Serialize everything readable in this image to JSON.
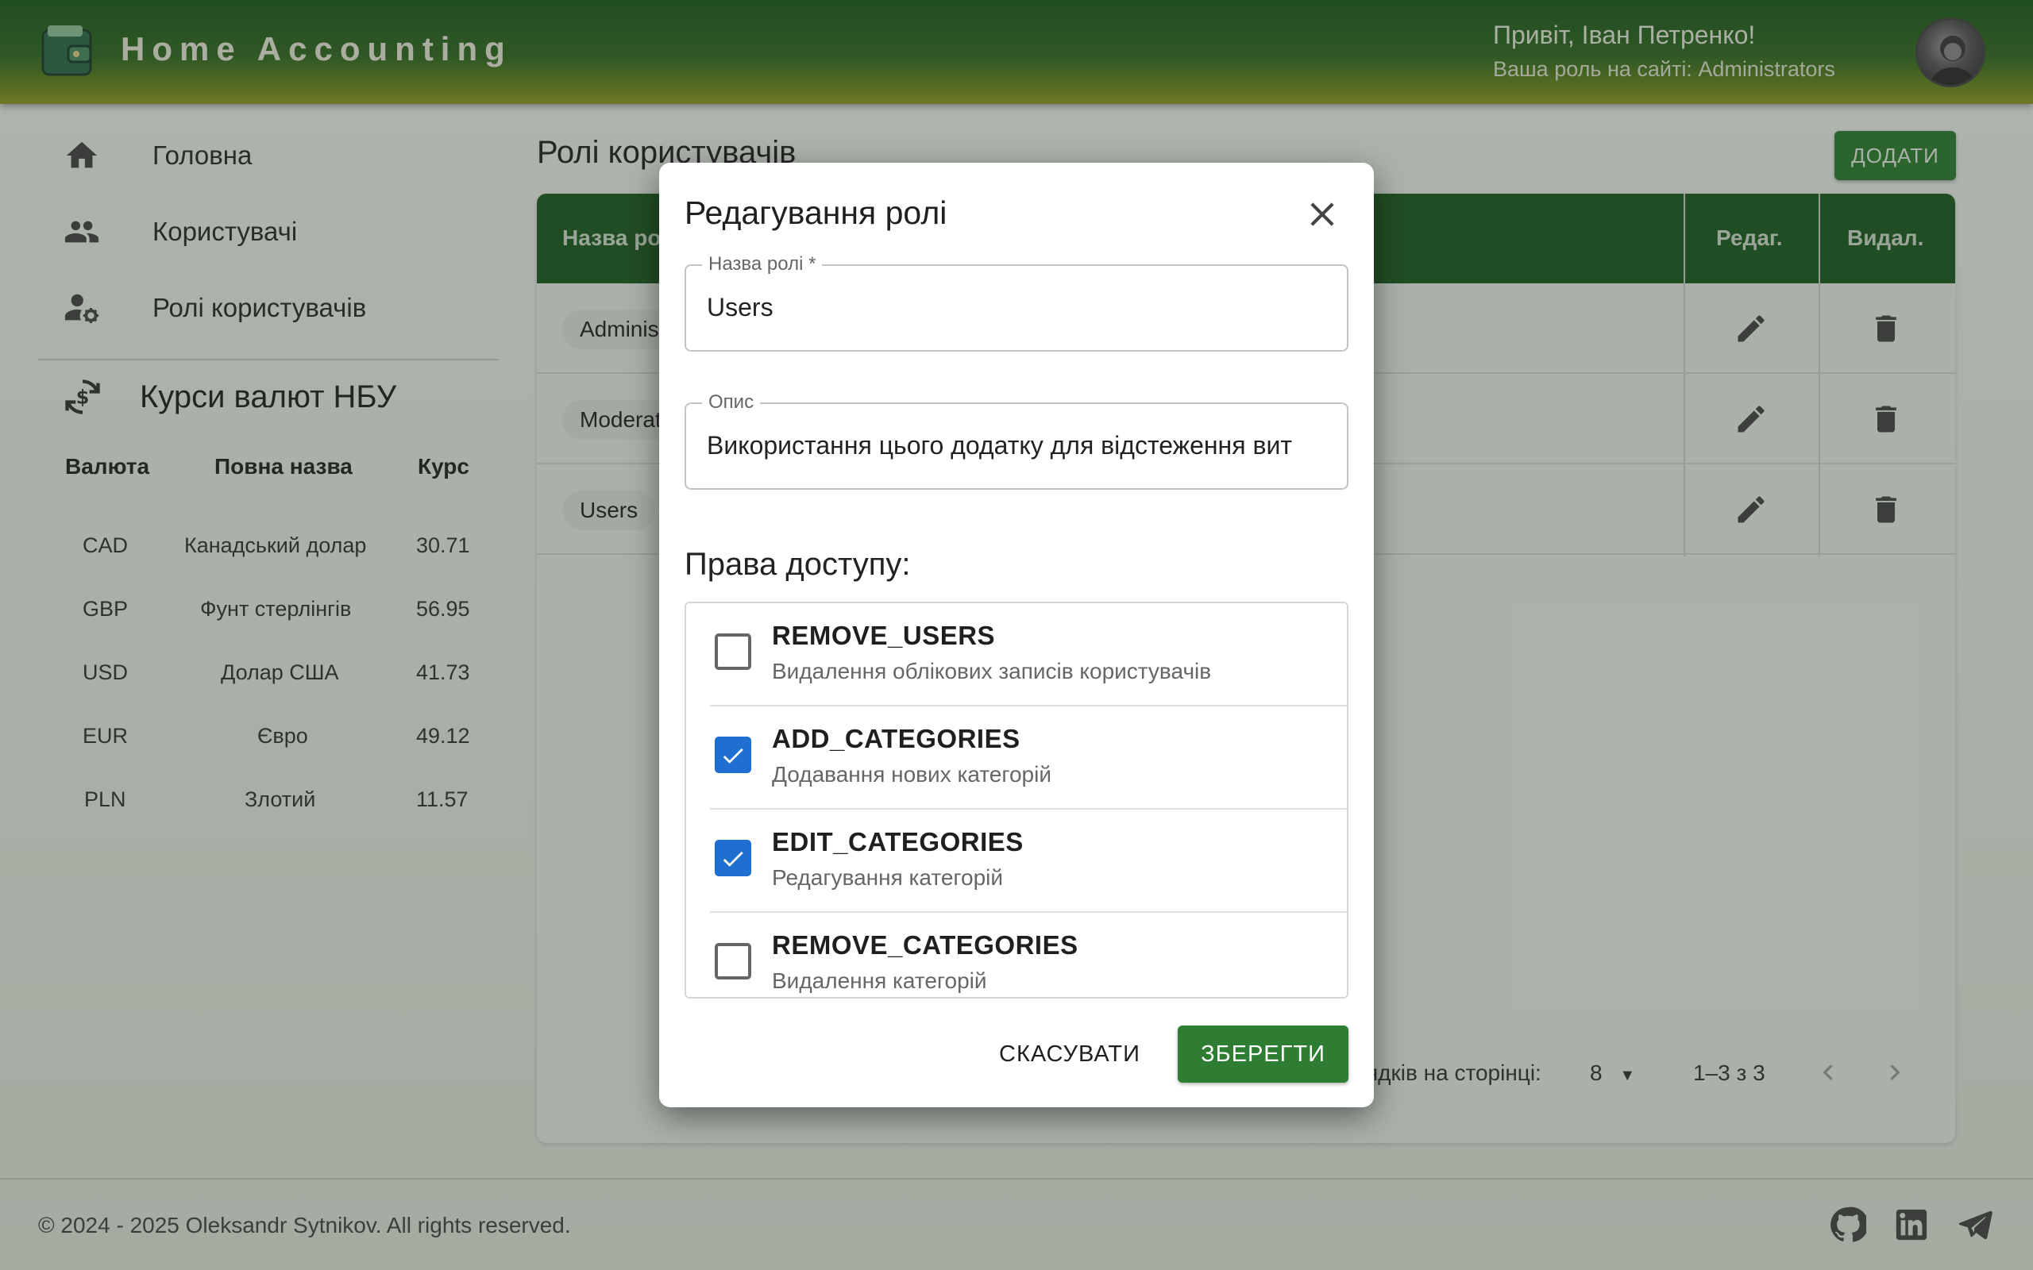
{
  "header": {
    "app_title": "Home Accounting",
    "greeting": "Привіт, Іван Петренко!",
    "role_line": "Ваша роль на сайті: Administrators"
  },
  "sidebar": {
    "items": [
      {
        "label": "Головна",
        "icon": "home-icon"
      },
      {
        "label": "Користувачі",
        "icon": "people-icon"
      },
      {
        "label": "Ролі користувачів",
        "icon": "user-settings-icon"
      }
    ]
  },
  "fx": {
    "title": "Курси валют НБУ",
    "headers": [
      "Валюта",
      "Повна назва",
      "Курс"
    ],
    "rows": [
      [
        "CAD",
        "Канадський долар",
        "30.71"
      ],
      [
        "GBP",
        "Фунт стерлінгів",
        "56.95"
      ],
      [
        "USD",
        "Долар США",
        "41.73"
      ],
      [
        "EUR",
        "Євро",
        "49.12"
      ],
      [
        "PLN",
        "Злотий",
        "11.57"
      ]
    ]
  },
  "main": {
    "page_title": "Ролі користувачів",
    "add_label": "ДОДАТИ",
    "columns": [
      "Назва ро",
      "Редаг.",
      "Видал."
    ],
    "rows": [
      "Adminis",
      "Moderat",
      "Users"
    ],
    "pager": {
      "rows_label": "ядків на сторінці:",
      "page_size": "8",
      "range": "1–3 з 3"
    }
  },
  "footer": {
    "copyright": "© 2024 - 2025 Oleksandr Sytnikov. All rights reserved."
  },
  "dialog": {
    "title": "Редагування ролі",
    "name_label": "Назва ролі *",
    "name_value": "Users",
    "desc_label": "Опис",
    "desc_value": "Використання цього додатку для відстеження вит",
    "perms_title": "Права доступу:",
    "permissions": [
      {
        "name": "REMOVE_USERS",
        "desc": "Видалення облікових записів користувачів",
        "checked": false
      },
      {
        "name": "ADD_CATEGORIES",
        "desc": "Додавання нових категорій",
        "checked": true
      },
      {
        "name": "EDIT_CATEGORIES",
        "desc": "Редагування категорій",
        "checked": true
      },
      {
        "name": "REMOVE_CATEGORIES",
        "desc": "Видалення категорій",
        "checked": false
      }
    ],
    "cancel_label": "СКАСУВАТИ",
    "save_label": "ЗБЕРЕГТИ"
  },
  "colors": {
    "primary": "#2e7d32",
    "header_dark": "#1e5b22",
    "checkbox": "#1e6fd0"
  }
}
